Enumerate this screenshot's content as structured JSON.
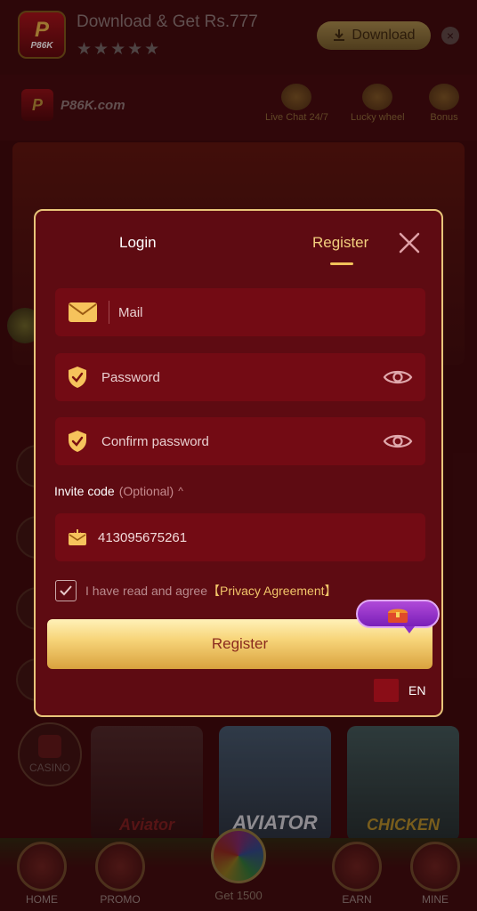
{
  "app_banner": {
    "logo_text": "P86K",
    "title": "Download & Get Rs.777",
    "rating_stars": "★★★★★",
    "download_label": "Download"
  },
  "header": {
    "brand_logo_text": "P",
    "brand_text": "P86K.com",
    "tools": [
      {
        "label": "Live Chat 24/7",
        "icon": "headset-icon"
      },
      {
        "label": "Lucky wheel",
        "icon": "wheel-icon"
      },
      {
        "label": "Bonus",
        "icon": "gift-icon"
      }
    ]
  },
  "background": {
    "casino_label": "CASINO",
    "games": [
      "Aviator",
      "AVIATOR",
      "CHICKEN"
    ],
    "nav": {
      "home": "HOME",
      "promo": "PROMO",
      "center": "Get 1500",
      "earn": "EARN",
      "mine": "MINE"
    }
  },
  "modal": {
    "tabs": {
      "login": "Login",
      "register": "Register"
    },
    "active_tab": "register",
    "fields": {
      "mail": {
        "placeholder": "Mail",
        "value": ""
      },
      "password": {
        "placeholder": "Password",
        "value": ""
      },
      "confirm": {
        "placeholder": "Confirm password",
        "value": ""
      },
      "invite": {
        "value": "413095675261"
      }
    },
    "invite_label": "Invite code",
    "invite_optional": "(Optional)",
    "invite_caret": "^",
    "agree_text": "I have read and agree",
    "agree_link": "【Privacy Agreement】",
    "agree_checked": true,
    "register_button": "Register",
    "language": "EN",
    "colors": {
      "accent": "#f2cf7e",
      "panel": "#5e0b12",
      "field": "#730b14"
    }
  }
}
